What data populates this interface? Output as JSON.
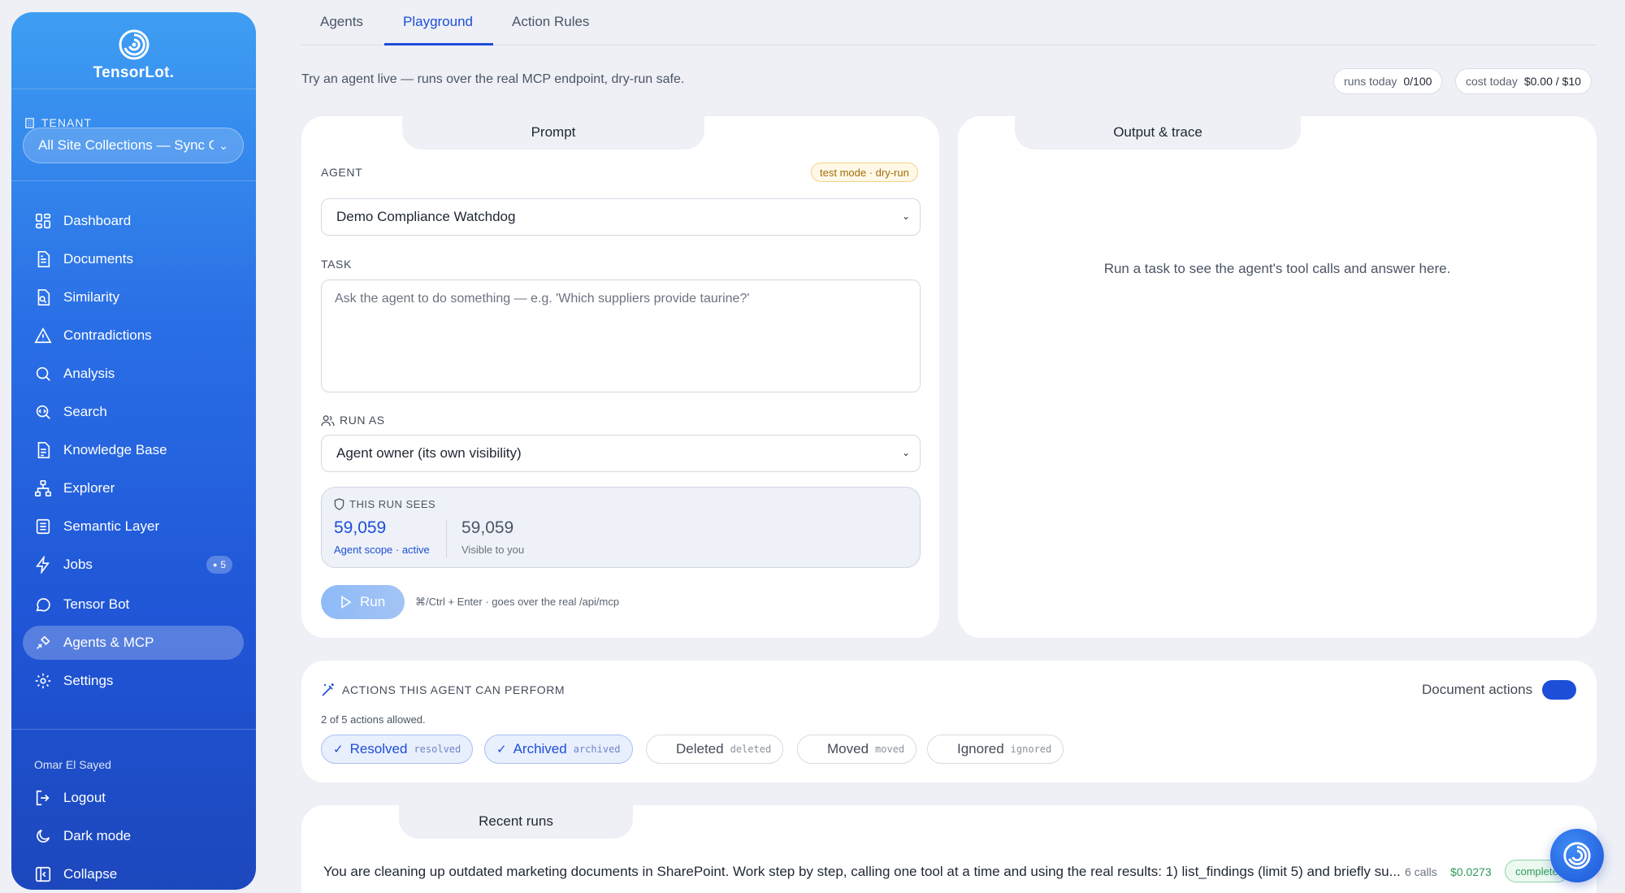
{
  "brand": {
    "name": "TensorLot."
  },
  "sidebar": {
    "tenant_label": "TENANT",
    "tenant_value": "All Site Collections — Sync Or",
    "items": [
      {
        "label": "Dashboard",
        "icon": "dashboard-icon"
      },
      {
        "label": "Documents",
        "icon": "document-icon"
      },
      {
        "label": "Similarity",
        "icon": "similarity-icon"
      },
      {
        "label": "Contradictions",
        "icon": "warning-icon"
      },
      {
        "label": "Analysis",
        "icon": "search-icon"
      },
      {
        "label": "Search",
        "icon": "search-code-icon"
      },
      {
        "label": "Knowledge Base",
        "icon": "book-icon"
      },
      {
        "label": "Explorer",
        "icon": "tree-icon"
      },
      {
        "label": "Semantic Layer",
        "icon": "layers-icon"
      },
      {
        "label": "Jobs",
        "icon": "bolt-icon",
        "badge": "5"
      },
      {
        "label": "Tensor Bot",
        "icon": "chat-icon"
      },
      {
        "label": "Agents & MCP",
        "icon": "agent-icon",
        "active": true
      },
      {
        "label": "Settings",
        "icon": "gear-icon"
      }
    ],
    "user_name": "Omar El Sayed",
    "bottom": [
      {
        "label": "Logout",
        "icon": "logout-icon"
      },
      {
        "label": "Dark mode",
        "icon": "moon-icon"
      },
      {
        "label": "Collapse",
        "icon": "collapse-icon"
      }
    ]
  },
  "tabs": [
    {
      "label": "Agents"
    },
    {
      "label": "Playground",
      "active": true
    },
    {
      "label": "Action Rules"
    }
  ],
  "intro": "Try an agent live — runs over the real MCP endpoint, dry-run safe.",
  "stats": {
    "runs_label": "runs today",
    "runs_value": "0/100",
    "cost_label": "cost today",
    "cost_value": "$0.00 / $10"
  },
  "prompt": {
    "tab": "Prompt",
    "agent_label": "AGENT",
    "test_mode": "test mode · dry-run",
    "agent_value": "Demo Compliance Watchdog",
    "task_label": "TASK",
    "task_placeholder": "Ask the agent to do something — e.g. 'Which suppliers provide taurine?'",
    "run_as_label": "RUN AS",
    "run_as_value": "Agent owner (its own visibility)",
    "sees_label": "THIS RUN SEES",
    "scope_count": "59,059",
    "scope_label": "Agent scope · active",
    "visible_count": "59,059",
    "visible_label": "Visible to you",
    "run_label": "Run",
    "hint": "⌘/Ctrl + Enter · goes over the real /api/mcp"
  },
  "output": {
    "tab": "Output & trace",
    "empty": "Run a task to see the agent's tool calls and answer here."
  },
  "actions": {
    "title": "ACTIONS THIS AGENT CAN PERFORM",
    "subtitle": "2 of 5 actions allowed.",
    "toggle_label": "Document actions",
    "chips": [
      {
        "label": "Resolved",
        "code": "resolved",
        "on": true
      },
      {
        "label": "Archived",
        "code": "archived",
        "on": true
      },
      {
        "label": "Deleted",
        "code": "deleted",
        "on": false
      },
      {
        "label": "Moved",
        "code": "moved",
        "on": false
      },
      {
        "label": "Ignored",
        "code": "ignored",
        "on": false
      }
    ]
  },
  "recent": {
    "tab": "Recent runs",
    "rows": [
      {
        "text": "You are cleaning up outdated marketing documents in SharePoint. Work step by step, calling one tool at a time and using the real results: 1) list_findings (limit 5) and briefly su...",
        "calls": "6 calls",
        "cost": "$0.0273",
        "status": "complete"
      }
    ]
  },
  "colors": {
    "accent": "#1d4ed8",
    "sidebar_top": "#3e9ef2",
    "sidebar_bottom": "#1d47bd"
  }
}
